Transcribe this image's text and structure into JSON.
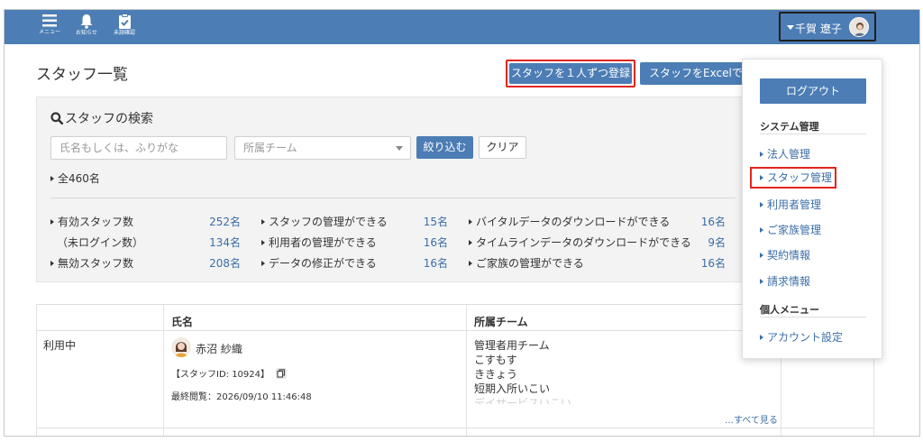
{
  "topbar": {
    "menu_label": "メニュー",
    "notice_label": "お知らせ",
    "unconfirmed_label": "未読確認",
    "user_name": "千賀 遼子"
  },
  "page": {
    "title": "スタッフ一覧",
    "register_one_label": "スタッフを１人ずつ登録",
    "register_excel_label": "スタッフをExcelで一括"
  },
  "search": {
    "title": "スタッフの検索",
    "name_placeholder": "氏名もしくは、ふりがな",
    "team_placeholder": "所属チーム",
    "filter_label": "絞り込む",
    "clear_label": "クリア",
    "total": "全460名"
  },
  "stats": {
    "col1": [
      {
        "label": "有効スタッフ数",
        "value": "252名",
        "arrow": true
      },
      {
        "label": "（未ログイン数）",
        "value": "134名",
        "arrow": false
      },
      {
        "label": "無効スタッフ数",
        "value": "208名",
        "arrow": true
      }
    ],
    "col2": [
      {
        "label": "スタッフの管理ができる",
        "value": "15名"
      },
      {
        "label": "利用者の管理ができる",
        "value": "16名"
      },
      {
        "label": "データの修正ができる",
        "value": "16名"
      }
    ],
    "col3": [
      {
        "label": "バイタルデータのダウンロードができる",
        "value": "16名"
      },
      {
        "label": "タイムラインデータのダウンロードができる",
        "value": "9名"
      },
      {
        "label": "ご家族の管理ができる",
        "value": "16名"
      }
    ]
  },
  "table": {
    "headers": {
      "name": "氏名",
      "team": "所属チーム"
    },
    "rows": [
      {
        "status": "利用中",
        "name": "赤沼 紗織",
        "staff_id": "【スタッフID: 10924】",
        "last_viewed": "最終閲覧：2026/09/10 11:46:48",
        "teams": [
          "管理者用チーム",
          "こすもす",
          "ききょう",
          "短期入所いこい",
          "デイサービスいこい"
        ],
        "see_all": "…すべて見る"
      }
    ]
  },
  "menu": {
    "logout_label": "ログアウト",
    "system_section": "システム管理",
    "system_items": [
      "法人管理",
      "スタッフ管理",
      "利用者管理",
      "ご家族管理",
      "契約情報",
      "請求情報"
    ],
    "personal_section": "個人メニュー",
    "personal_items": [
      "アカウント設定"
    ]
  },
  "colors": {
    "primary": "#4c7db5",
    "highlight": "#e0261f",
    "link": "#3b6ea8"
  }
}
